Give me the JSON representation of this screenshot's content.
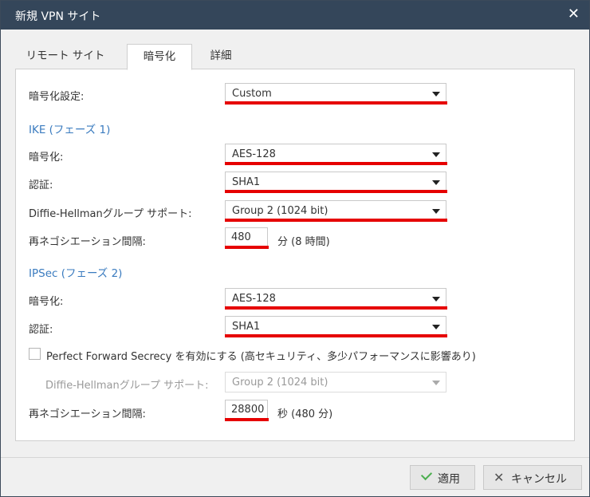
{
  "window": {
    "title": "新規 VPN サイト"
  },
  "tabs": [
    {
      "label": "リモート サイト"
    },
    {
      "label": "暗号化"
    },
    {
      "label": "詳細"
    }
  ],
  "encryption_settings": {
    "label": "暗号化設定:",
    "value": "Custom"
  },
  "ike": {
    "heading": "IKE (フェーズ 1)",
    "encryption": {
      "label": "暗号化:",
      "value": "AES-128"
    },
    "auth": {
      "label": "認証:",
      "value": "SHA1"
    },
    "dh": {
      "label": "Diffie-Hellmanグループ サポート:",
      "value": "Group 2 (1024 bit)"
    },
    "renegotiation": {
      "label": "再ネゴシエーション間隔:",
      "value": "480",
      "unit": "分 (8 時間)"
    }
  },
  "ipsec": {
    "heading": "IPSec (フェーズ 2)",
    "encryption": {
      "label": "暗号化:",
      "value": "AES-128"
    },
    "auth": {
      "label": "認証:",
      "value": "SHA1"
    },
    "pfs": {
      "label": "Perfect Forward Secrecy を有効にする (高セキュリティ、多少パフォーマンスに影響あり)",
      "checked": false
    },
    "dh": {
      "label": "Diffie-Hellmanグループ サポート:",
      "value": "Group 2 (1024 bit)"
    },
    "renegotiation": {
      "label": "再ネゴシエーション間隔:",
      "value": "28800",
      "unit": "秒 (480 分)"
    }
  },
  "buttons": {
    "apply": "適用",
    "cancel": "キャンセル"
  },
  "colors": {
    "titlebar": "#34465a",
    "accent": "#3a7bbf",
    "highlight": "#e60000"
  }
}
